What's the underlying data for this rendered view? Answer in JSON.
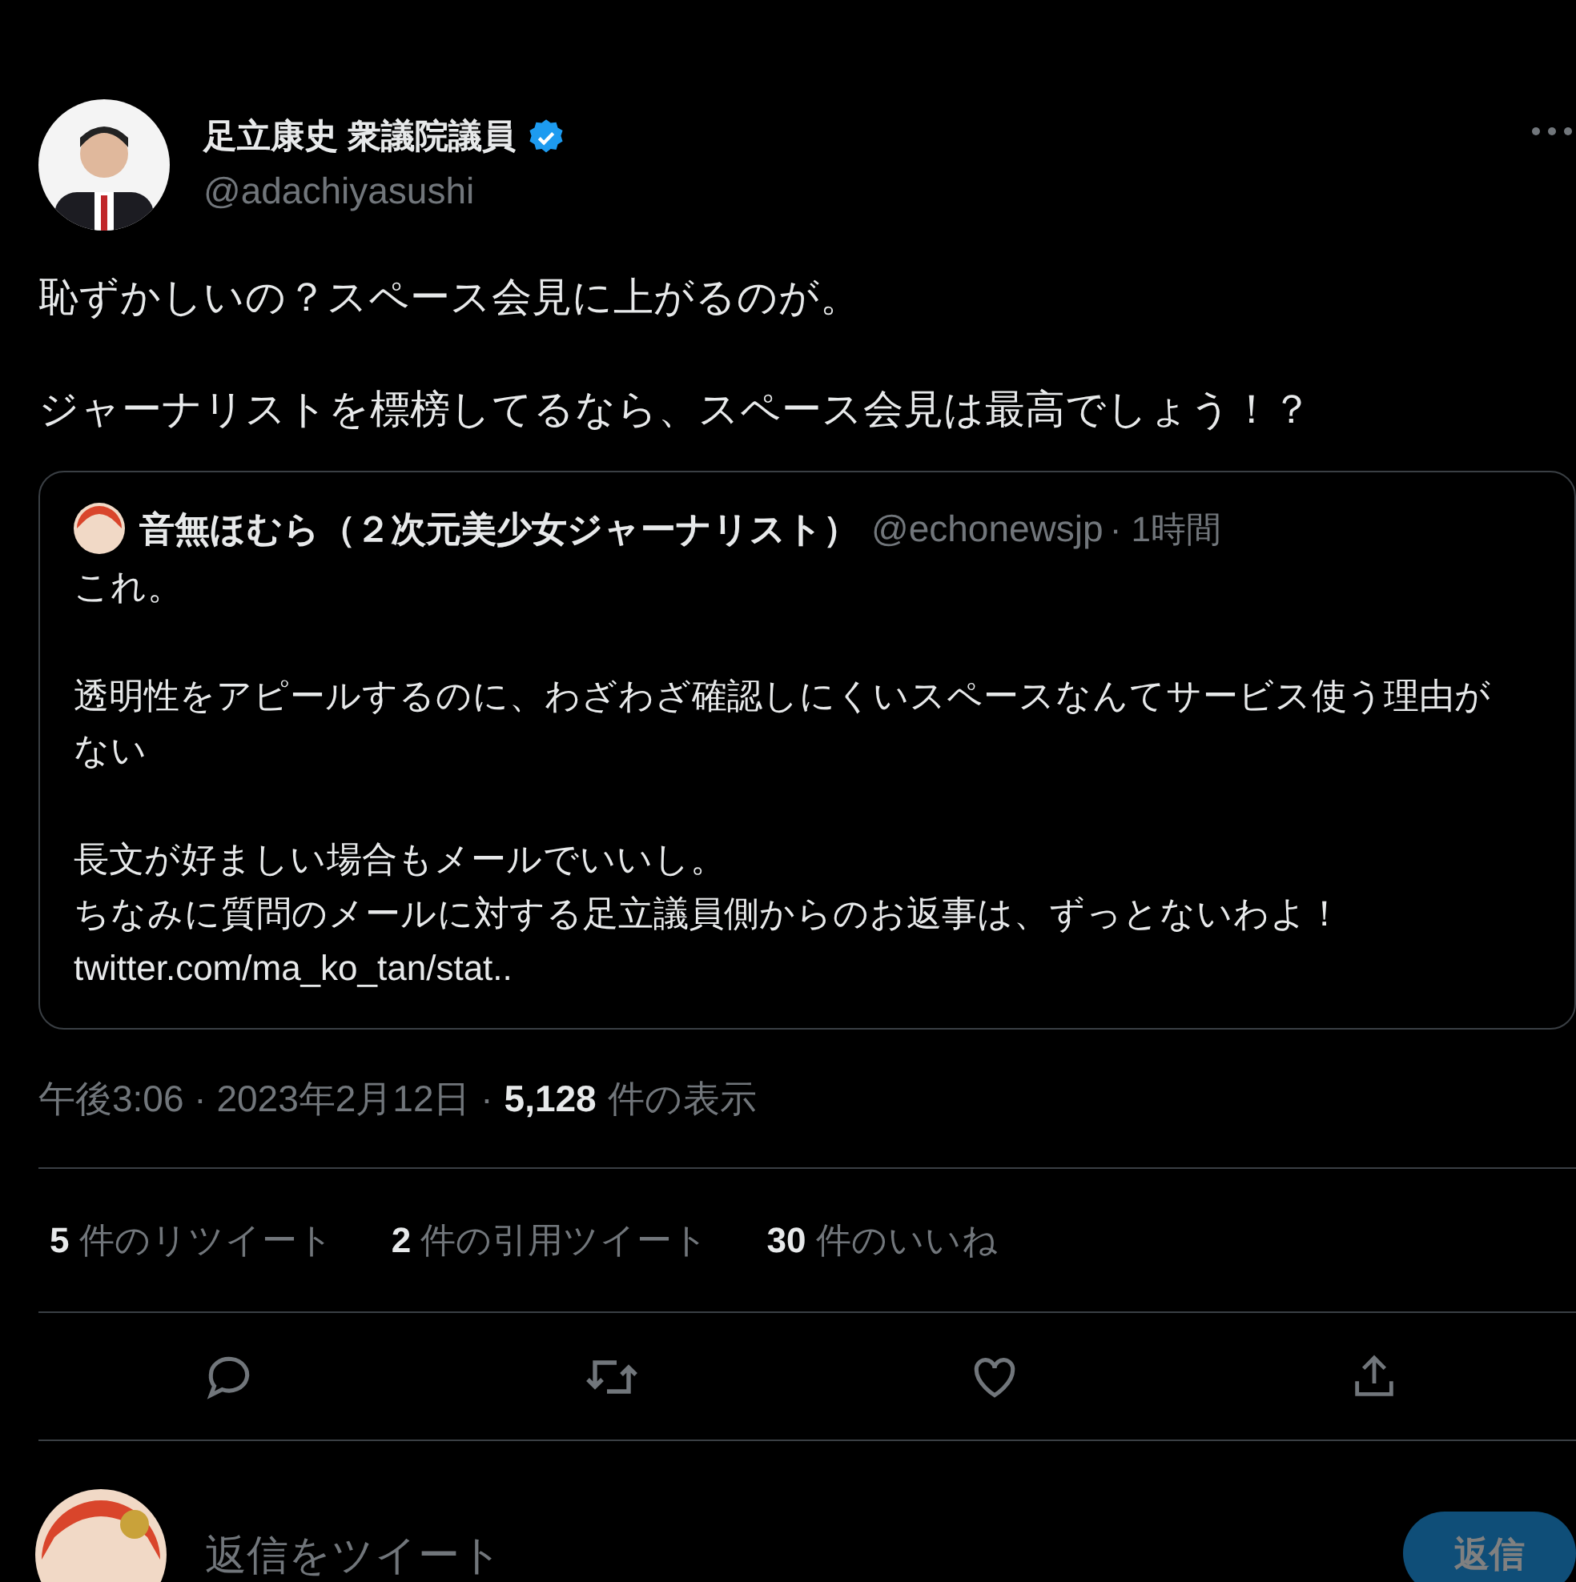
{
  "tweet": {
    "author": {
      "name": "足立康史 衆議院議員",
      "handle": "@adachiyasushi",
      "verified": true
    },
    "text": [
      "恥ずかしいの？スペース会見に上がるのが。",
      "ジャーナリストを標榜してるなら、スペース会見は最高でしょう！？"
    ],
    "quote": {
      "name": "音無ほむら（２次元美少女ジャーナリスト）",
      "handle": "@echonewsjp",
      "time": "· 1時間",
      "paragraphs": [
        [
          "これ。"
        ],
        [
          "透明性をアピールするのに、わざわざ確認しにくいスペースなんてサービス使う理由がない"
        ],
        [
          "長文が好ましい場合もメールでいいし。",
          "ちなみに質問のメールに対する足立議員側からのお返事は、ずっとないわよ！",
          "twitter.com/ma_ko_tan/stat.."
        ]
      ]
    },
    "meta": {
      "time": "午後3:06 · 2023年2月12日 ·",
      "views": "5,128",
      "views_label": "件の表示"
    },
    "stats": [
      {
        "count": "5",
        "label": "件のリツイート"
      },
      {
        "count": "2",
        "label": "件の引用ツイート"
      },
      {
        "count": "30",
        "label": "件のいいね"
      }
    ],
    "actions": [
      {
        "kind": "reply"
      },
      {
        "kind": "retweet"
      },
      {
        "kind": "like"
      },
      {
        "kind": "share"
      }
    ]
  },
  "reply_box": {
    "placeholder": "返信をツイート",
    "button": "返信"
  }
}
